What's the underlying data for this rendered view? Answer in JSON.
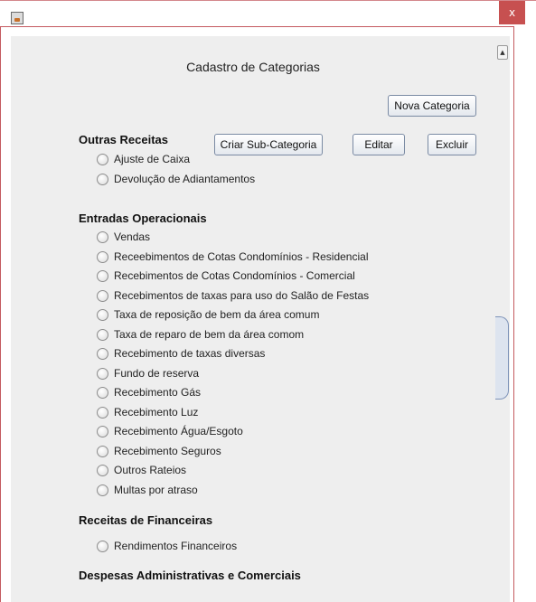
{
  "window": {
    "app_icon": "java-cup-icon",
    "close_label": "x"
  },
  "page": {
    "title": "Cadastro de Categorias",
    "buttons": {
      "nova_categoria": "Nova Categoria",
      "criar_sub": "Criar Sub-Categoria",
      "editar": "Editar",
      "excluir": "Excluir"
    }
  },
  "sections": [
    {
      "title": "Outras Receitas",
      "items": [
        "Ajuste de Caixa",
        "Devolução de Adiantamentos"
      ]
    },
    {
      "title": "Entradas Operacionais",
      "items": [
        "Vendas",
        "Receebimentos de Cotas Condomínios - Residencial",
        "Recebimentos de Cotas Condomínios - Comercial",
        "Recebimentos de taxas para uso do Salão de Festas",
        "Taxa de reposição de bem da área comum",
        "Taxa de reparo de bem da área comom",
        "Recebimento de taxas diversas",
        "Fundo de reserva",
        "Recebimento Gás",
        "Recebimento Luz",
        "Recebimento Água/Esgoto",
        "Recebimento Seguros",
        "Outros Rateios",
        "Multas por atraso"
      ]
    },
    {
      "title": "Receitas de Financeiras",
      "items": [
        "Rendimentos Financeiros"
      ]
    },
    {
      "title": "Despesas Administrativas e Comerciais",
      "items": []
    }
  ],
  "colors": {
    "panel_bg": "#eeeeee",
    "close_bg": "#c75050",
    "frame_border": "#c45a60"
  }
}
